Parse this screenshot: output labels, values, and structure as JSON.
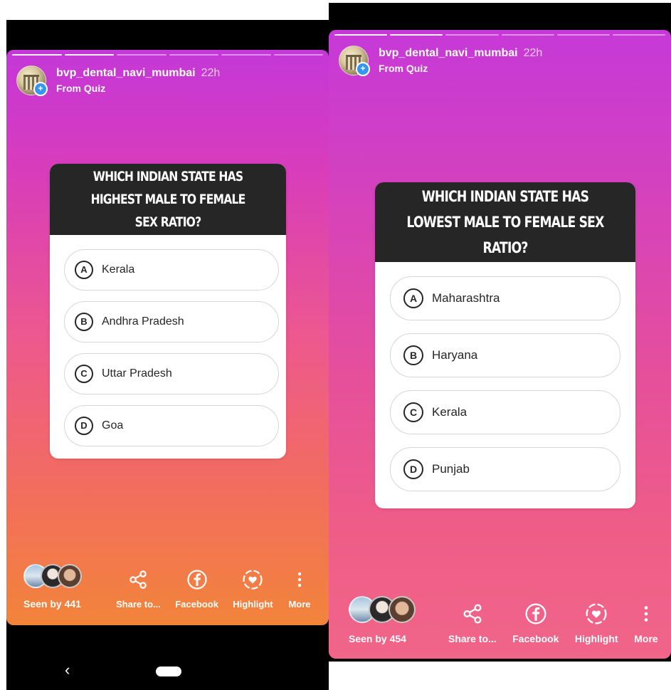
{
  "stories": [
    {
      "progress": {
        "segments": 6,
        "completed": 2
      },
      "username": "bvp_dental_navi_mumbai",
      "time": "22h",
      "subtitle": "From Quiz",
      "question": "WHICH INDIAN STATE HAS HIGHEST MALE TO FEMALE SEX RATIO?",
      "options": [
        {
          "letter": "A",
          "text": "Kerala"
        },
        {
          "letter": "B",
          "text": "Andhra Pradesh"
        },
        {
          "letter": "C",
          "text": "Uttar Pradesh"
        },
        {
          "letter": "D",
          "text": "Goa"
        }
      ],
      "seen": "Seen by 441",
      "actions": {
        "share": "Share to...",
        "facebook": "Facebook",
        "highlight": "Highlight",
        "more": "More"
      }
    },
    {
      "progress": {
        "segments": 6,
        "completed": 2
      },
      "username": "bvp_dental_navi_mumbai",
      "time": "22h",
      "subtitle": "From Quiz",
      "question": "WHICH INDIAN STATE HAS  LOWEST MALE TO FEMALE SEX RATIO?",
      "options": [
        {
          "letter": "A",
          "text": "Maharashtra"
        },
        {
          "letter": "B",
          "text": "Haryana"
        },
        {
          "letter": "C",
          "text": "Kerala"
        },
        {
          "letter": "D",
          "text": "Punjab"
        }
      ],
      "seen": "Seen by 454",
      "actions": {
        "share": "Share to...",
        "facebook": "Facebook",
        "highlight": "Highlight",
        "more": "More"
      }
    }
  ],
  "navbar": {
    "back_icon": "chevron-left-icon",
    "back_glyph": "‹",
    "home_icon": "home-pill-icon"
  },
  "colors": {
    "card_header": "#262626",
    "verified_badge": "#3797f0"
  }
}
